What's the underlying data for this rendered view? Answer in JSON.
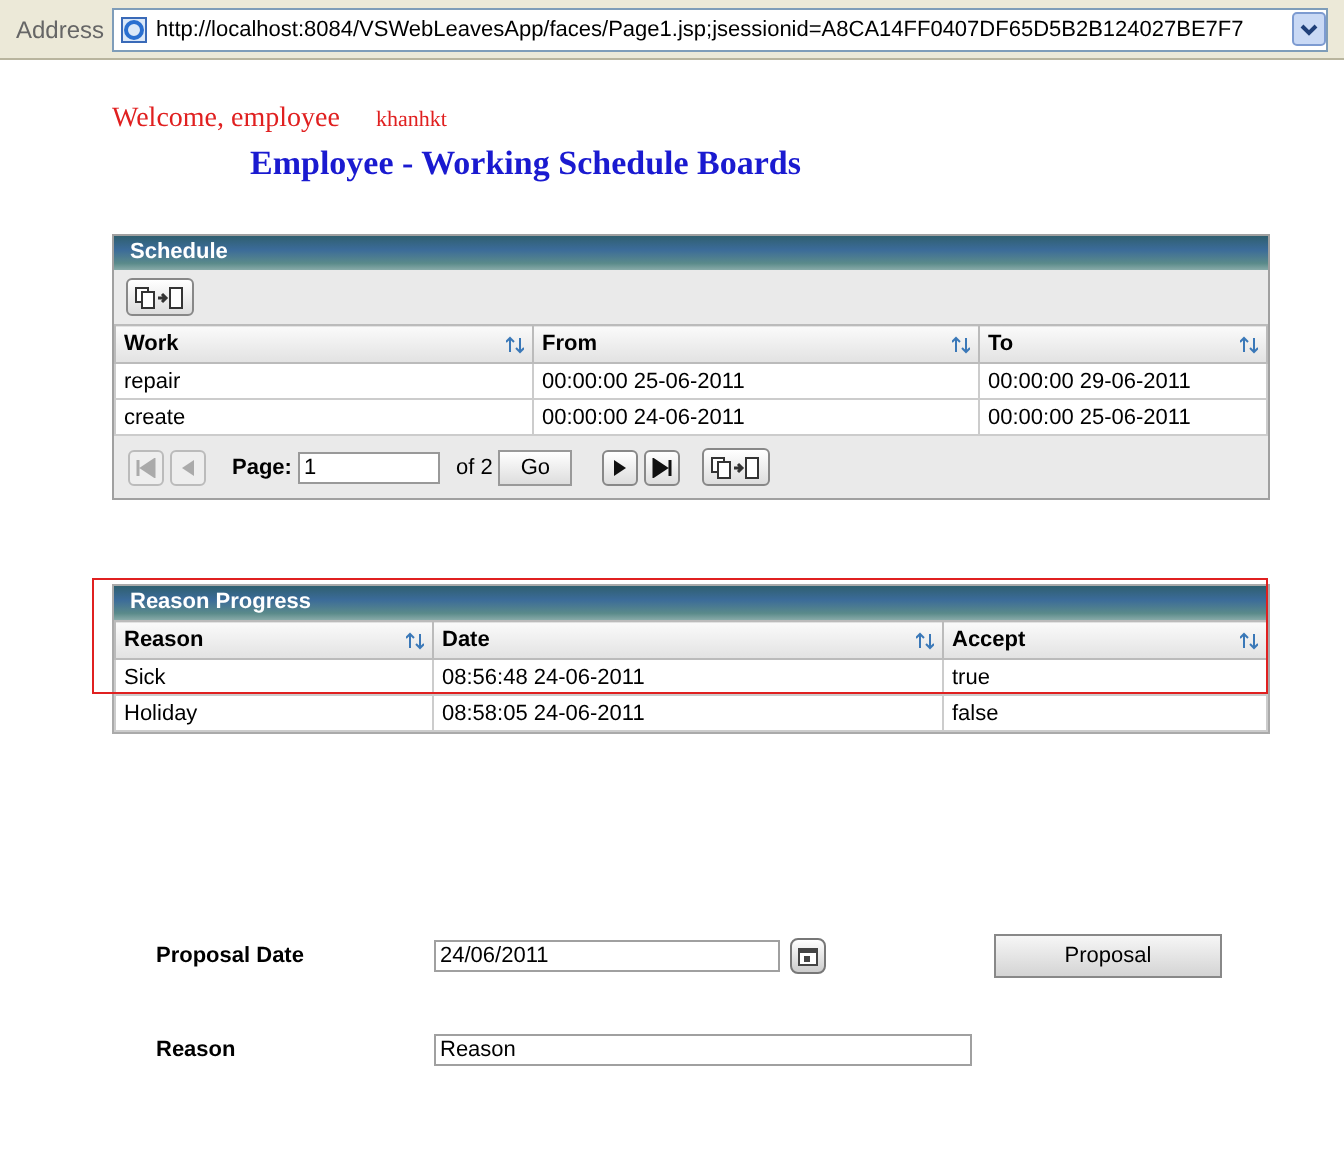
{
  "address_bar": {
    "label": "Address",
    "url": "http://localhost:8084/VSWebLeavesApp/faces/Page1.jsp;jsessionid=A8CA14FF0407DF65D5B2B124027BE7F7"
  },
  "welcome": {
    "text": "Welcome, employee",
    "user": "khanhkt"
  },
  "page_title": "Employee - Working Schedule Boards",
  "schedule": {
    "title": "Schedule",
    "columns": [
      "Work",
      "From",
      "To"
    ],
    "rows": [
      [
        "repair",
        "00:00:00 25-06-2011",
        "00:00:00 29-06-2011"
      ],
      [
        "create",
        "00:00:00 24-06-2011",
        "00:00:00 25-06-2011"
      ]
    ],
    "pager": {
      "first_disabled": true,
      "prev_disabled": true,
      "page_label": "Page:",
      "page": "1",
      "of": "of 2",
      "go": "Go"
    }
  },
  "reason_progress": {
    "title": "Reason Progress",
    "highlighted": true,
    "columns": [
      "Reason",
      "Date",
      "Accept"
    ],
    "rows": [
      [
        "Sick",
        "08:56:48 24-06-2011",
        "true"
      ],
      [
        "Holiday",
        "08:58:05 24-06-2011",
        "false"
      ]
    ]
  },
  "form": {
    "date_label": "Proposal Date",
    "date_value": "24/06/2011",
    "button": "Proposal",
    "reason_label": "Reason",
    "reason_value": "Reason"
  }
}
